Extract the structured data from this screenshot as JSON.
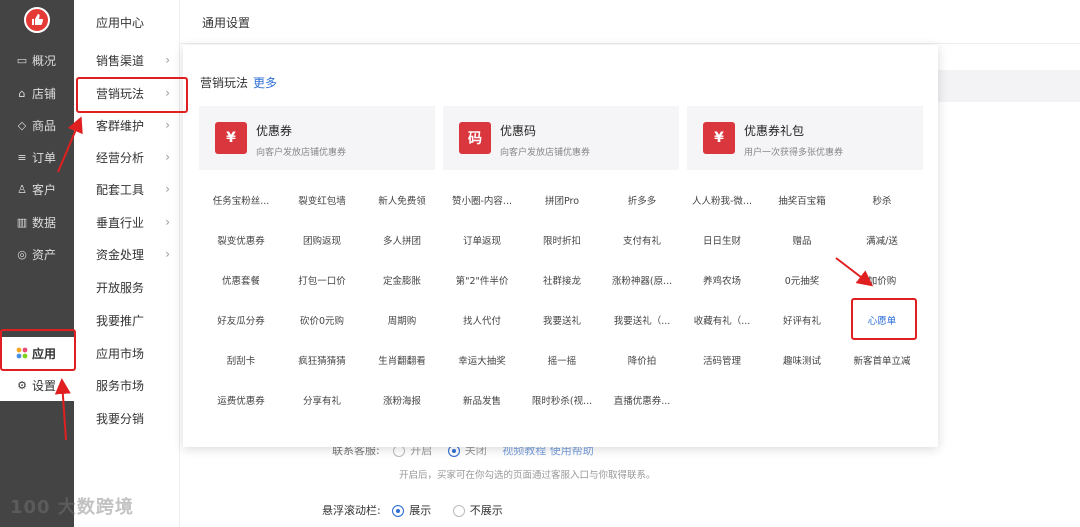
{
  "nav": {
    "items": [
      {
        "label": "概况",
        "icon": "monitor-icon"
      },
      {
        "label": "店铺",
        "icon": "store-icon"
      },
      {
        "label": "商品",
        "icon": "tag-icon"
      },
      {
        "label": "订单",
        "icon": "list-icon"
      },
      {
        "label": "客户",
        "icon": "user-icon"
      },
      {
        "label": "数据",
        "icon": "bar-chart-icon"
      },
      {
        "label": "资产",
        "icon": "coin-icon"
      }
    ],
    "app_label": "应用",
    "settings_label": "设置"
  },
  "sub": {
    "head": "应用中心",
    "items": [
      "销售渠道",
      "营销玩法",
      "客群维护",
      "经营分析",
      "配套工具",
      "垂直行业",
      "资金处理",
      "开放服务",
      "我要推广",
      "应用市场",
      "服务市场",
      "我要分销"
    ]
  },
  "header": {
    "title": "通用设置"
  },
  "popup": {
    "title": "营销玩法",
    "more": "更多",
    "cards": [
      {
        "icon_text": "¥",
        "title": "优惠券",
        "desc": "向客户发放店铺优惠券"
      },
      {
        "icon_text": "码",
        "title": "优惠码",
        "desc": "向客户发放店铺优惠券"
      },
      {
        "icon_text": "¥",
        "title": "优惠券礼包",
        "desc": "用户一次获得多张优惠券"
      }
    ],
    "grid": [
      [
        "任务宝粉丝...",
        "裂变红包墙",
        "新人免费领",
        "赞小圈-内容...",
        "拼团Pro",
        "折多多",
        "人人粉我-微...",
        "抽奖百宝箱",
        "秒杀"
      ],
      [
        "裂变优惠券",
        "团购返现",
        "多人拼团",
        "订单返现",
        "限时折扣",
        "支付有礼",
        "日日生财",
        "赠品",
        "满减/送"
      ],
      [
        "优惠套餐",
        "打包一口价",
        "定金膨胀",
        "第\"2\"件半价",
        "社群接龙",
        "涨粉神器(原...",
        "养鸡农场",
        "0元抽奖",
        "加价购"
      ],
      [
        "好友瓜分券",
        "砍价0元购",
        "周期购",
        "找人代付",
        "我要送礼",
        "我要送礼（...",
        "收藏有礼（...",
        "好评有礼",
        "心愿单"
      ],
      [
        "刮刮卡",
        "疯狂猜猜猜",
        "生肖翻翻看",
        "幸运大抽奖",
        "摇一摇",
        "降价拍",
        "活码管理",
        "趣味测试",
        "新客首单立减"
      ],
      [
        "运费优惠券",
        "分享有礼",
        "涨粉海报",
        "新品发售",
        "限时秒杀(视...",
        "直播优惠券..."
      ]
    ]
  },
  "form": {
    "contact_label": "联系客服:",
    "contact_on": "开启",
    "contact_off": "关闭",
    "contact_links": "视频教程  使用帮助",
    "contact_hint": "开启后，买家可在你勾选的页面通过客服入口与你取得联系。",
    "float_label": "悬浮滚动栏:",
    "float_show": "展示",
    "float_hide": "不展示"
  },
  "watermark": "100 大数跨境",
  "colors": {
    "brand": "#d9363e",
    "link": "#2f6fd6",
    "annotation": "#e02020"
  }
}
